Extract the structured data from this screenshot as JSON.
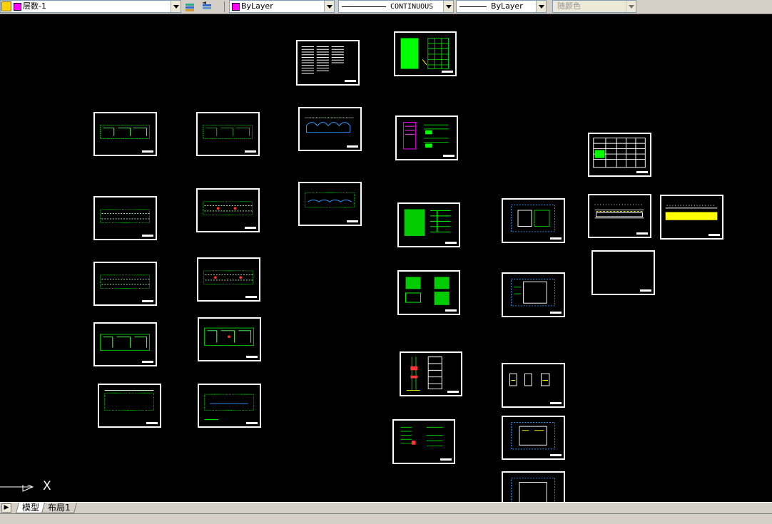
{
  "toolbar": {
    "layer_name": "层数-1",
    "color_value": "ByLayer",
    "linetype_value": "CONTINUOUS",
    "lineweight_value": "ByLayer",
    "plotstyle_value": "随颜色"
  },
  "ucs": {
    "x_label": "X"
  },
  "tabs": [
    {
      "label": "模型"
    },
    {
      "label": "布局1"
    }
  ]
}
